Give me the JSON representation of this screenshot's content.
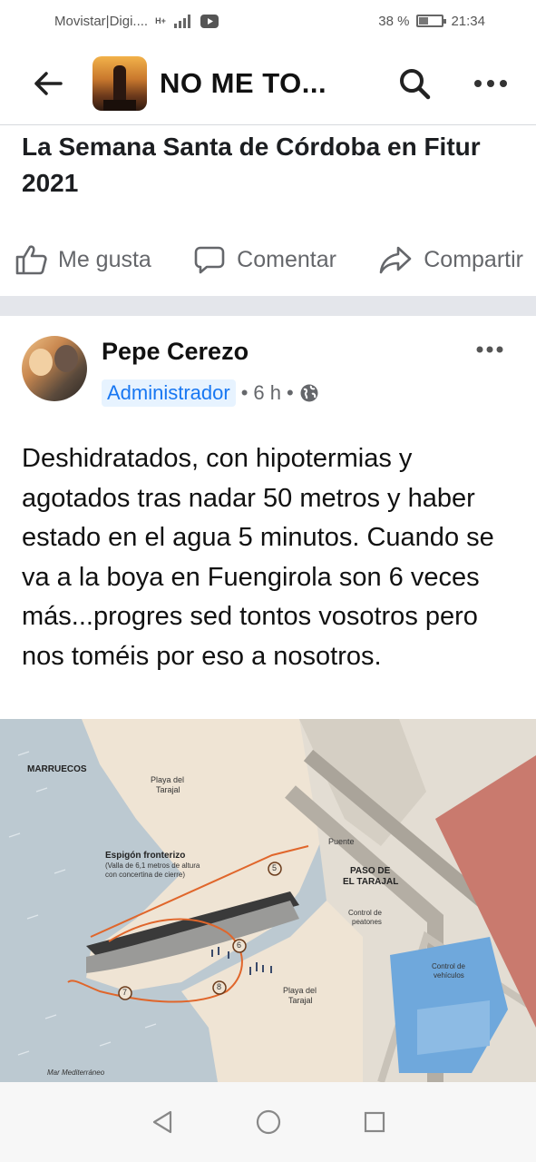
{
  "status_bar": {
    "carrier": "Movistar|Digi....",
    "signal_text": "H+",
    "battery_percent": "38 %",
    "battery_level": 0.38,
    "time": "21:34"
  },
  "header": {
    "group_name": "NO ME TO...",
    "icons": [
      "back-arrow-icon",
      "search-icon",
      "more-icon"
    ]
  },
  "shared_post": {
    "title": "La Semana Santa de Córdoba en Fitur 2021"
  },
  "actions": {
    "like": "Me gusta",
    "comment": "Comentar",
    "share": "Compartir"
  },
  "post": {
    "author": "Pepe Cerezo",
    "role": "Administrador",
    "time": "6 h",
    "separator": "•",
    "text": "Deshidratados, con hipotermias y agotados tras nadar 50 metros y haber estado en el agua 5 minutos. Cuando se va a la boya en Fuengirola son 6 veces más...progres sed tontos vosotros pero nos toméis por eso a nosotros."
  },
  "map": {
    "labels": {
      "marruecos": "MARRUECOS",
      "playa_tarajal_top_1": "Playa del",
      "playa_tarajal_top_2": "Tarajal",
      "espigon_1": "Espigón fronterizo",
      "espigon_2": "(Valla de 6,1 metros de altura",
      "espigon_3": "con concertina de cierre)",
      "puente": "Puente",
      "paso_1": "PASO DE",
      "paso_2": "EL TARAJAL",
      "control_peatones_1": "Control de",
      "control_peatones_2": "peatones",
      "control_vehiculos_1": "Control de",
      "control_vehiculos_2": "vehículos",
      "playa_tarajal_bottom_1": "Playa del",
      "playa_tarajal_bottom_2": "Tarajal",
      "mar": "Mar Mediterráneo",
      "n5": "5",
      "n6": "6",
      "n7": "7",
      "n8": "8"
    },
    "colors": {
      "sea": "#bcc9d1",
      "sand": "#efe4d4",
      "route": "#e0662b",
      "building": "#c97a6e",
      "control": "#6fa8dc"
    }
  },
  "nav": {
    "icons": [
      "back-triangle-icon",
      "home-circle-icon",
      "recents-square-icon"
    ]
  }
}
